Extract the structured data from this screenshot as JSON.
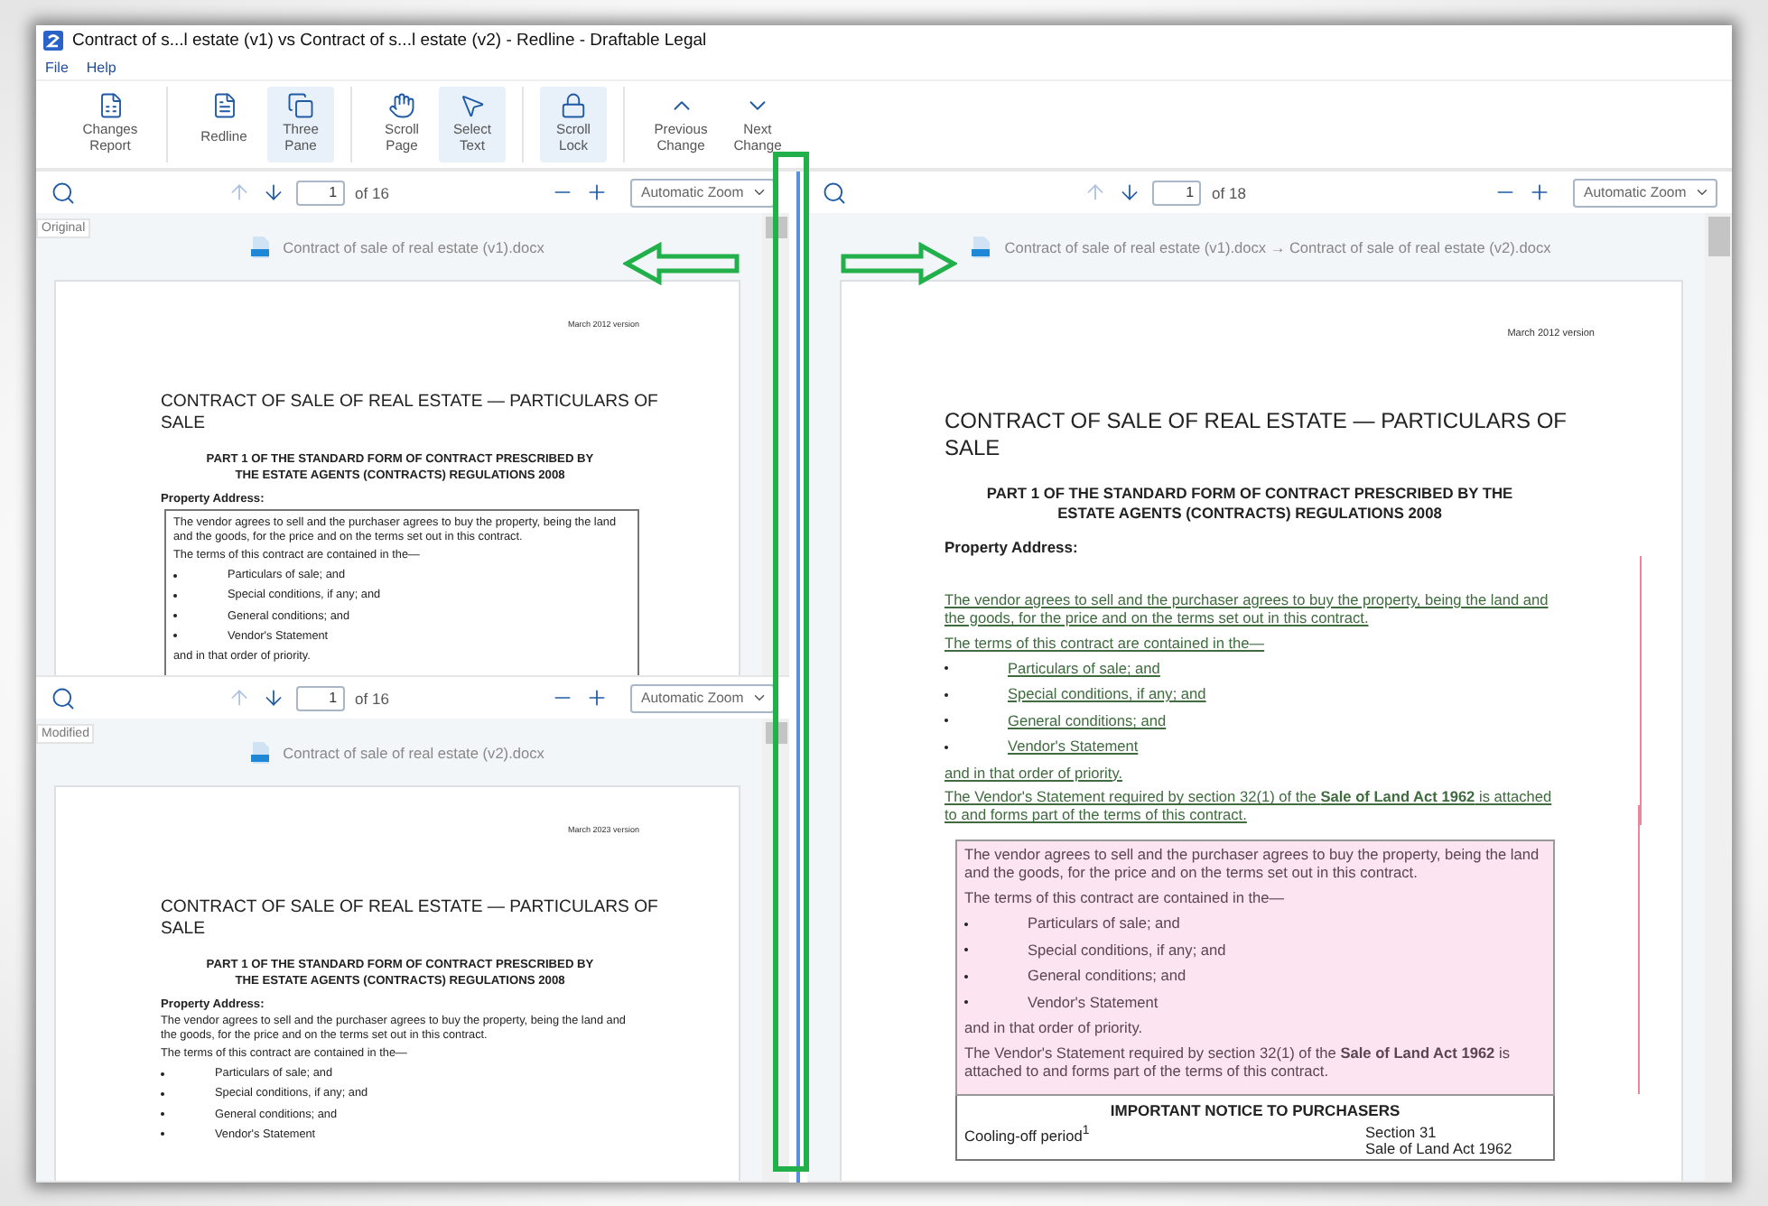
{
  "window": {
    "title": "Contract of s...l estate (v1) vs Contract of s...l estate (v2) - Redline - Draftable Legal"
  },
  "menu": [
    {
      "label": "File"
    },
    {
      "label": "Help"
    }
  ],
  "toolbar_groups": [
    [
      {
        "kind": "report",
        "label": [
          "Changes",
          "Report"
        ],
        "selected": false
      }
    ],
    [
      {
        "kind": "redline",
        "label": [
          "Redline"
        ],
        "selected": false
      },
      {
        "kind": "panes",
        "label": [
          "Three",
          "Pane"
        ],
        "selected": true
      }
    ],
    [
      {
        "kind": "hand",
        "label": [
          "Scroll",
          "Page"
        ],
        "selected": false
      },
      {
        "kind": "pointer",
        "label": [
          "Select",
          "Text"
        ],
        "selected": true
      }
    ],
    [
      {
        "kind": "lock",
        "label": [
          "Scroll",
          "Lock"
        ],
        "selected": true
      }
    ],
    [
      {
        "kind": "up",
        "label": [
          "Previous",
          "Change"
        ],
        "selected": false
      },
      {
        "kind": "down",
        "label": [
          "Next",
          "Change"
        ],
        "selected": false
      }
    ]
  ],
  "panes": [
    {
      "tag": "Original",
      "page": "1",
      "page_count": "of 16",
      "zoom": "Automatic Zoom",
      "file": "Contract of sale of real estate (v1).docx",
      "document": {
        "version_note": "March 2012 version",
        "title": "CONTRACT OF SALE OF REAL ESTATE — PARTICULARS OF SALE",
        "subtitle": "PART 1 OF THE STANDARD FORM OF CONTRACT PRESCRIBED BY THE ESTATE AGENTS (CONTRACTS) REGULATIONS 2008",
        "address_label": "Property Address:",
        "sections": [
          {
            "boxed": true,
            "lines": [
              {
                "kind": "para",
                "text": "The vendor agrees to sell and the purchaser agrees to buy the property, being the land and the goods, for the price and on the terms set out in this contract."
              },
              {
                "kind": "para",
                "text": "The terms of this contract are contained in the—"
              },
              {
                "kind": "bullet",
                "text": "Particulars of sale; and"
              },
              {
                "kind": "bullet",
                "text": "Special conditions, if any; and"
              },
              {
                "kind": "bullet",
                "text": "General conditions; and"
              },
              {
                "kind": "bullet",
                "text": "Vendor's Statement"
              },
              {
                "kind": "para",
                "text": "and in that order of priority."
              }
            ]
          }
        ]
      }
    },
    {
      "tag": "Modified",
      "page": "1",
      "page_count": "of 16",
      "zoom": "Automatic Zoom",
      "file": "Contract of sale of real estate (v2).docx",
      "document": {
        "version_note": "March 2023 version",
        "title": "CONTRACT OF SALE OF REAL ESTATE — PARTICULARS OF SALE",
        "subtitle": "PART 1 OF THE STANDARD FORM OF CONTRACT PRESCRIBED BY THE ESTATE AGENTS (CONTRACTS) REGULATIONS 2008",
        "address_label": "Property Address:",
        "sections": [
          {
            "boxed": false,
            "lines": [
              {
                "kind": "para",
                "text": "The vendor agrees to sell and the purchaser agrees to buy the property, being the land and the goods, for the price and on the terms set out in this contract."
              },
              {
                "kind": "para",
                "text": "The terms of this contract are contained in the—"
              },
              {
                "kind": "bullet",
                "text": "Particulars of sale; and"
              },
              {
                "kind": "bullet",
                "text": "Special conditions, if any; and"
              },
              {
                "kind": "bullet",
                "text": "General conditions; and"
              },
              {
                "kind": "bullet",
                "text": "Vendor's Statement"
              }
            ]
          }
        ]
      }
    },
    {
      "page": "1",
      "page_count": "of 18",
      "zoom": "Automatic Zoom",
      "file": "Contract of sale of real estate (v1).docx → Contract of sale of real estate (v2).docx",
      "document": {
        "version_note": "March 2012 version",
        "title": "CONTRACT OF SALE OF REAL ESTATE — PARTICULARS OF SALE",
        "subtitle": "PART 1 OF THE STANDARD FORM OF CONTRACT PRESCRIBED BY THE ESTATE AGENTS (CONTRACTS) REGULATIONS 2008",
        "address_label": "Property Address:",
        "sections": [
          {
            "boxed": false,
            "inserted": true,
            "deleted": false,
            "lines": [
              {
                "kind": "para",
                "text": "The vendor agrees to sell and the purchaser agrees to buy the property, being the land and the goods, for the price and on the terms set out in this contract."
              },
              {
                "kind": "para",
                "text": "The terms of this contract are contained in the—"
              },
              {
                "kind": "bullet",
                "text": "Particulars of sale; and"
              },
              {
                "kind": "bullet",
                "text": "Special conditions, if any; and"
              },
              {
                "kind": "bullet",
                "text": "General conditions; and"
              },
              {
                "kind": "bullet",
                "text": "Vendor's Statement"
              },
              {
                "kind": "para",
                "text": "and in that order of priority."
              },
              {
                "kind": "para",
                "text": "The Vendor's Statement required by section 32(1) of the **Sale of Land Act 1962** is attached to and forms part of the terms of this contract."
              }
            ]
          },
          {
            "boxed": true,
            "inserted": false,
            "deleted": true,
            "lines": [
              {
                "kind": "para",
                "text": "The vendor agrees to sell and the purchaser agrees to buy the property, being the land and the goods, for the price and on the terms set out in this contract."
              },
              {
                "kind": "para",
                "text": "The terms of this contract are contained in the—"
              },
              {
                "kind": "bullet",
                "text": "Particulars of sale; and"
              },
              {
                "kind": "bullet",
                "text": "Special conditions, if any; and"
              },
              {
                "kind": "bullet",
                "text": "General conditions; and"
              },
              {
                "kind": "bullet",
                "text": "Vendor's Statement"
              },
              {
                "kind": "para",
                "text": "and in that order of priority."
              },
              {
                "kind": "para",
                "text": "The Vendor's Statement required by section 32(1) of the **Sale of Land Act 1962** is attached to and forms part of the terms of this contract."
              }
            ]
          }
        ],
        "notice": {
          "heading": "IMPORTANT NOTICE TO PURCHASERS",
          "rows": [
            {
              "label": "Cooling-off period$^{1}$",
              "reference": [
                "Section 31",
                "Sale of Land Act 1962"
              ]
            }
          ]
        }
      }
    }
  ]
}
